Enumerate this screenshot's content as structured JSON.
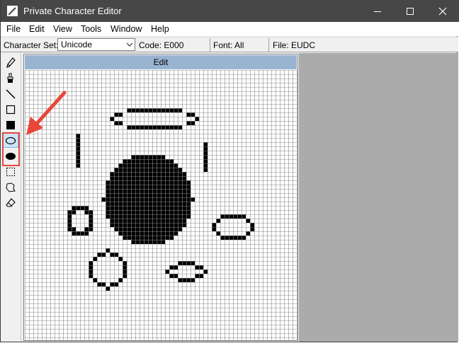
{
  "window": {
    "title": "Private Character Editor"
  },
  "menu": {
    "items": [
      "File",
      "Edit",
      "View",
      "Tools",
      "Window",
      "Help"
    ]
  },
  "infobar": {
    "charset_label": "Character Set:",
    "charset_value": "Unicode",
    "code": "Code: E000",
    "font": "Font: All",
    "file": "File: EUDC"
  },
  "tools": [
    {
      "name": "pencil-tool",
      "icon": "pencil-icon"
    },
    {
      "name": "brush-tool",
      "icon": "brush-icon"
    },
    {
      "name": "straight-line-tool",
      "icon": "line-icon"
    },
    {
      "name": "hollow-rectangle-tool",
      "icon": "hollow-rectangle-icon"
    },
    {
      "name": "filled-rectangle-tool",
      "icon": "filled-rectangle-icon"
    },
    {
      "name": "hollow-ellipse-tool",
      "icon": "hollow-ellipse-icon"
    },
    {
      "name": "filled-ellipse-tool",
      "icon": "filled-ellipse-icon"
    },
    {
      "name": "rectangular-selection-tool",
      "icon": "rectangular-selection-icon"
    },
    {
      "name": "freeform-selection-tool",
      "icon": "freeform-selection-icon"
    },
    {
      "name": "eraser-tool",
      "icon": "eraser-icon"
    }
  ],
  "selected_tool": "hollow-ellipse-tool",
  "editor": {
    "header": "Edit",
    "grid_size": 64
  },
  "colors": {
    "titlebar": "#474747",
    "edit_header": "#99b4d1",
    "highlight": "#e8463a",
    "gray_pane": "#ababab"
  }
}
